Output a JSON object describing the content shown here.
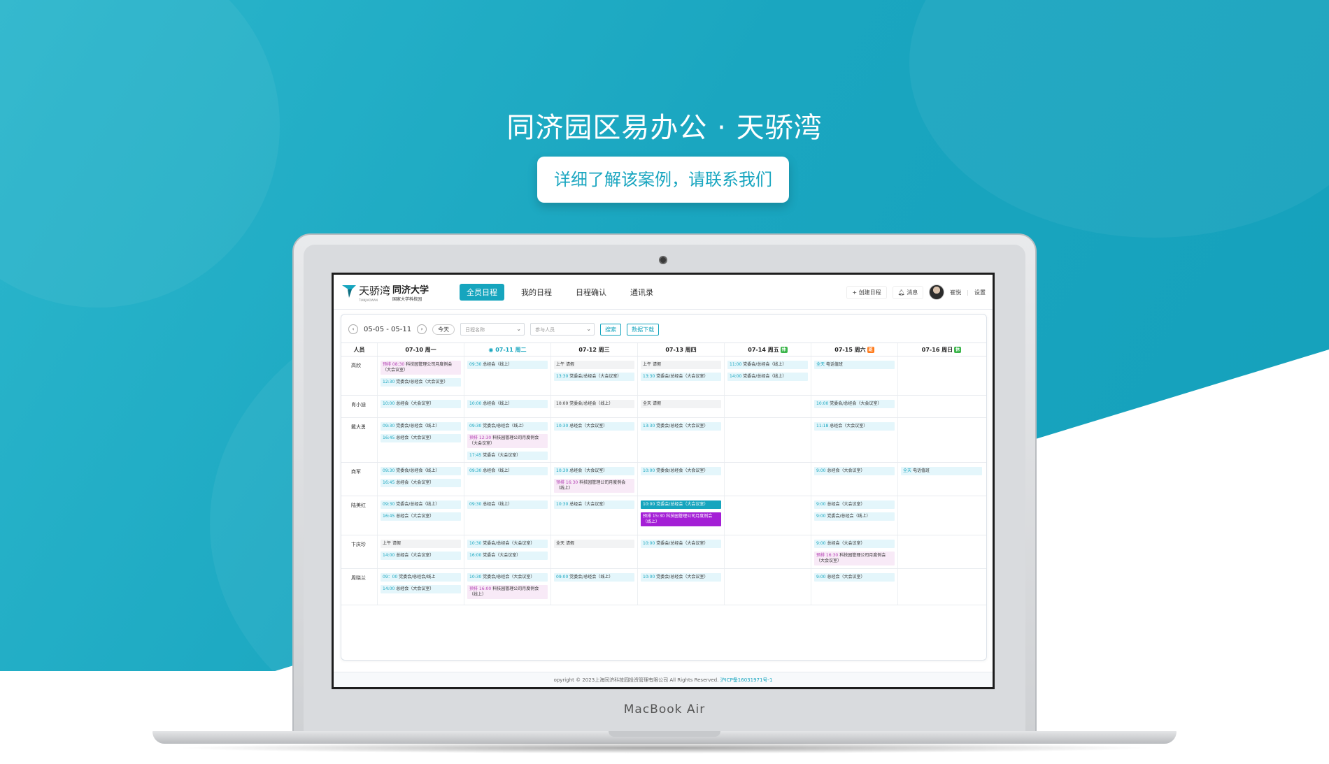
{
  "hero": {
    "title": "同济园区易办公 · 天骄湾",
    "cta": "详细了解该案例，请联系我们"
  },
  "device": {
    "brand": "MacBook Air"
  },
  "app": {
    "logo_text": "天骄湾",
    "logo_sub": "TIANJIAOWAN",
    "logo2_main": "同济大学",
    "logo2_sub": "国家大学科技园",
    "nav": [
      "全员日程",
      "我的日程",
      "日程确认",
      "通讯录"
    ],
    "header": {
      "create": "+ 创建日程",
      "messages": "消息",
      "user": "崔悦",
      "divider": "|",
      "settings": "设置"
    },
    "toolbar": {
      "range": "05-05 - 05-11",
      "today": "今天",
      "schedule_placeholder": "日程名称",
      "participant_placeholder": "参与人员",
      "search": "搜索",
      "download": "数据下载"
    },
    "columns_label": "人员",
    "days": [
      {
        "label": "07-10 周一",
        "badge": "",
        "today": false
      },
      {
        "label": "07-11 周二",
        "badge": "",
        "today": true
      },
      {
        "label": "07-12 周三",
        "badge": "",
        "today": false
      },
      {
        "label": "07-13 周四",
        "badge": "",
        "today": false
      },
      {
        "label": "07-14 周五",
        "badge": "休",
        "badge_color": "green",
        "today": false
      },
      {
        "label": "07-15 周六",
        "badge": "班",
        "badge_color": "orange",
        "today": false
      },
      {
        "label": "07-16 周日",
        "badge": "休",
        "badge_color": "green",
        "today": false
      }
    ],
    "rows": [
      {
        "person": "高欣",
        "height": 56,
        "cells": [
          [
            {
              "s": "pink",
              "t": "预排 08:30",
              "x": "科技园管理公司月度例会（大会议室）"
            },
            {
              "s": "blue",
              "t": "12:30",
              "x": "党委会/总经会（大会议室）"
            }
          ],
          [
            {
              "s": "blue",
              "t": "09:30",
              "x": "总经会（线上）"
            }
          ],
          [
            {
              "s": "gray",
              "t": "上午",
              "x": "请假"
            },
            {
              "s": "blue",
              "t": "13:30",
              "x": "党委会/总经会（大会议室）"
            }
          ],
          [
            {
              "s": "gray",
              "t": "上午",
              "x": "请假"
            },
            {
              "s": "blue",
              "t": "13:30",
              "x": "党委会/总经会（大会议室）"
            }
          ],
          [
            {
              "s": "blue",
              "t": "11:00",
              "x": "党委会/总经会（线上）"
            },
            {
              "s": "blue",
              "t": "14:00",
              "x": "党委会/总经会（线上）"
            }
          ],
          [
            {
              "s": "blue",
              "t": "全天",
              "x": "电话值班"
            }
          ],
          []
        ]
      },
      {
        "person": "肖小迪",
        "height": 32,
        "cells": [
          [
            {
              "s": "blue",
              "t": "10:00",
              "x": "总经会（大会议室）"
            }
          ],
          [
            {
              "s": "blue",
              "t": "10:00",
              "x": "总经会（线上）"
            }
          ],
          [
            {
              "s": "gray",
              "t": "10:00",
              "x": "党委会/总经会（线上）"
            }
          ],
          [
            {
              "s": "gray",
              "t": "全天",
              "x": "请假"
            }
          ],
          [],
          [
            {
              "s": "blue",
              "t": "10:00",
              "x": "党委会/总经会（大会议室）"
            }
          ],
          []
        ]
      },
      {
        "person": "戴大勇",
        "height": 64,
        "cells": [
          [
            {
              "s": "blue",
              "t": "09:30",
              "x": "党委会/总经会（线上）"
            },
            {
              "s": "blue",
              "t": "16:45",
              "x": "总经会（大会议室）"
            }
          ],
          [
            {
              "s": "blue",
              "t": "09:30",
              "x": "党委会/总经会（线上）"
            },
            {
              "s": "pink",
              "t": "预排 12:30",
              "x": "科技园管理公司月度例会（大会议室）"
            },
            {
              "s": "blue",
              "t": "17:45",
              "x": "党委会（大会议室）"
            }
          ],
          [
            {
              "s": "blue",
              "t": "10:30",
              "x": "总经会（大会议室）"
            }
          ],
          [
            {
              "s": "blue",
              "t": "13:30",
              "x": "党委会/总经会（大会议室）"
            }
          ],
          [],
          [
            {
              "s": "blue",
              "t": "11:18",
              "x": "总经会（大会议室）"
            }
          ],
          []
        ]
      },
      {
        "person": "商军",
        "height": 48,
        "cells": [
          [
            {
              "s": "blue",
              "t": "09:30",
              "x": "党委会/总经会（线上）"
            },
            {
              "s": "blue",
              "t": "16:45",
              "x": "总经会（大会议室）"
            }
          ],
          [
            {
              "s": "blue",
              "t": "09:30",
              "x": "总经会（线上）"
            }
          ],
          [
            {
              "s": "blue",
              "t": "10:30",
              "x": "总经会（大会议室）"
            },
            {
              "s": "pink",
              "t": "预排 16:30",
              "x": "科技园管理公司月度例会（线上）"
            }
          ],
          [
            {
              "s": "blue",
              "t": "10:00",
              "x": "党委会/总经会（大会议室）"
            }
          ],
          [],
          [
            {
              "s": "blue",
              "t": "9:00",
              "x": "总经会（大会议室）"
            }
          ],
          [
            {
              "s": "blue",
              "t": "全天",
              "x": "电话值班"
            }
          ]
        ]
      },
      {
        "person": "陆美红",
        "height": 56,
        "cells": [
          [
            {
              "s": "blue",
              "t": "09:30",
              "x": "党委会/总经会（线上）"
            },
            {
              "s": "blue",
              "t": "16:45",
              "x": "总经会（大会议室）"
            }
          ],
          [
            {
              "s": "blue",
              "t": "09:30",
              "x": "总经会（线上）"
            }
          ],
          [
            {
              "s": "blue",
              "t": "10:30",
              "x": "总经会（大会议室）"
            }
          ],
          [
            {
              "s": "teal-solid",
              "t": "10:00",
              "x": "党委会/总经会（大会议室）"
            },
            {
              "s": "purple-solid",
              "t": "预排 15:30",
              "x": "科技园管理公司月度例会（线上）"
            }
          ],
          [],
          [
            {
              "s": "blue",
              "t": "9:00",
              "x": "总经会（大会议室）"
            },
            {
              "s": "blue",
              "t": "9:00",
              "x": "党委会/总经会（线上）"
            }
          ],
          []
        ]
      },
      {
        "person": "卞庆珍",
        "height": 48,
        "cells": [
          [
            {
              "s": "gray",
              "t": "上午",
              "x": "请假"
            },
            {
              "s": "blue",
              "t": "14:00",
              "x": "总经会（大会议室）"
            }
          ],
          [
            {
              "s": "blue",
              "t": "10:30",
              "x": "党委会/总经会（大会议室）"
            },
            {
              "s": "blue",
              "t": "16:00",
              "x": "党委会（大会议室）"
            }
          ],
          [
            {
              "s": "gray",
              "t": "全天",
              "x": "请假"
            }
          ],
          [
            {
              "s": "blue",
              "t": "10:00",
              "x": "党委会/总经会（大会议室）"
            }
          ],
          [],
          [
            {
              "s": "blue",
              "t": "9:00",
              "x": "总经会（大会议室）"
            },
            {
              "s": "pink",
              "t": "预排 16:30",
              "x": "科技园管理公司月度例会（大会议室）"
            }
          ],
          []
        ]
      },
      {
        "person": "周晓兰",
        "height": 52,
        "cells": [
          [
            {
              "s": "blue",
              "t": "09：00",
              "x": "党委会/总经会/线上"
            },
            {
              "s": "blue",
              "t": "14:00",
              "x": "总经会（大会议室）"
            }
          ],
          [
            {
              "s": "blue",
              "t": "10:30",
              "x": "党委会/总经会（大会议室）"
            },
            {
              "s": "pink",
              "t": "预排 16:00",
              "x": "科技园管理公司月度例会（线上）"
            }
          ],
          [
            {
              "s": "blue",
              "t": "09:00",
              "x": "党委会/总经会（线上）"
            }
          ],
          [
            {
              "s": "blue",
              "t": "10:00",
              "x": "党委会/总经会（大会议室）"
            }
          ],
          [],
          [
            {
              "s": "blue",
              "t": "9:00",
              "x": "总经会（大会议室）"
            }
          ],
          []
        ]
      }
    ],
    "footer": {
      "copyright": "opyright © 2023上海同济科技园投资管理有限公司 All Rights Reserved.",
      "icp": "沪ICP备16031971号-1"
    }
  }
}
